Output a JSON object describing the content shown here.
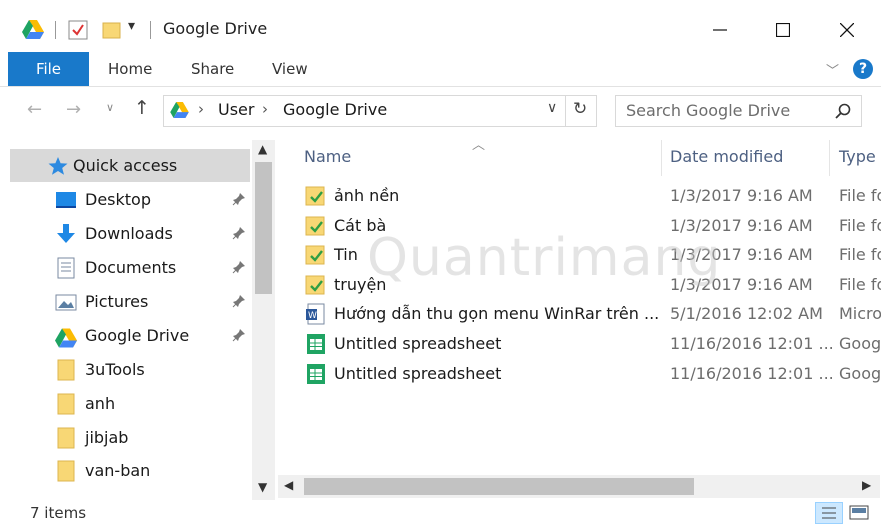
{
  "window": {
    "title": "Google Drive"
  },
  "ribbon": {
    "tabs": [
      "File",
      "Home",
      "Share",
      "View"
    ]
  },
  "address": {
    "segments": [
      "User",
      "Google Drive"
    ],
    "separator": "›"
  },
  "search": {
    "placeholder": "Search Google Drive"
  },
  "nav": {
    "items": [
      {
        "label": "Quick access",
        "icon": "star-icon"
      },
      {
        "label": "Desktop",
        "icon": "desktop-icon"
      },
      {
        "label": "Downloads",
        "icon": "download-icon"
      },
      {
        "label": "Documents",
        "icon": "documents-icon"
      },
      {
        "label": "Pictures",
        "icon": "pictures-icon"
      },
      {
        "label": "Google Drive",
        "icon": "google-drive-icon"
      },
      {
        "label": "3uTools",
        "icon": "folder-icon"
      },
      {
        "label": "anh",
        "icon": "folder-icon"
      },
      {
        "label": "jibjab",
        "icon": "folder-icon"
      },
      {
        "label": "van-ban",
        "icon": "folder-icon"
      }
    ]
  },
  "columns": {
    "name": "Name",
    "date": "Date modified",
    "type": "Type"
  },
  "files": [
    {
      "name": "ảnh nền",
      "date": "1/3/2017 9:16 AM",
      "type": "File fo",
      "icon": "synced-folder-icon"
    },
    {
      "name": "Cát bà",
      "date": "1/3/2017 9:16 AM",
      "type": "File fo",
      "icon": "synced-folder-icon"
    },
    {
      "name": "Tin",
      "date": "1/3/2017 9:16 AM",
      "type": "File fo",
      "icon": "synced-folder-icon"
    },
    {
      "name": "truyện",
      "date": "1/3/2017 9:16 AM",
      "type": "File fo",
      "icon": "synced-folder-icon"
    },
    {
      "name": "Hướng dẫn thu gọn menu WinRar trên ...",
      "date": "5/1/2016 12:02 AM",
      "type": "Micro",
      "icon": "word-doc-icon"
    },
    {
      "name": "Untitled spreadsheet",
      "date": "11/16/2016 12:01 ...",
      "type": "Goog",
      "icon": "sheets-icon"
    },
    {
      "name": "Untitled spreadsheet",
      "date": "11/16/2016 12:01 ...",
      "type": "Goog",
      "icon": "sheets-icon"
    }
  ],
  "status": {
    "item_count": "7 items"
  },
  "watermark": {
    "text": "Quantrimang"
  },
  "colors": {
    "accent": "#1979ca",
    "selection": "#cce8ff",
    "nav_selected": "#d9d9d9",
    "folder": "#f8d775",
    "check": "#3aa83a"
  }
}
